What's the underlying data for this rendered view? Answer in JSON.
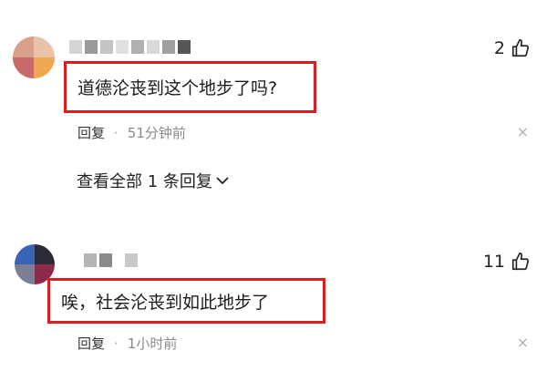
{
  "comments": [
    {
      "likes": "2",
      "text": "道德沦丧到这个地步了吗?",
      "reply_label": "回复",
      "separator": "·",
      "time": "51分钟前",
      "close": "×",
      "view_all": "查看全部 1 条回复"
    },
    {
      "likes": "11",
      "text": "唉，社会沦丧到如此地步了",
      "reply_label": "回复",
      "separator": "·",
      "time": "1小时前",
      "close": "×"
    }
  ],
  "colors": {
    "highlight_border": "#d81e1e",
    "meta_text": "#8a8a8a",
    "primary_text": "#222222"
  },
  "icons": {
    "like": "thumbs-up-icon",
    "expand": "chevron-down-icon",
    "close": "close-icon"
  }
}
